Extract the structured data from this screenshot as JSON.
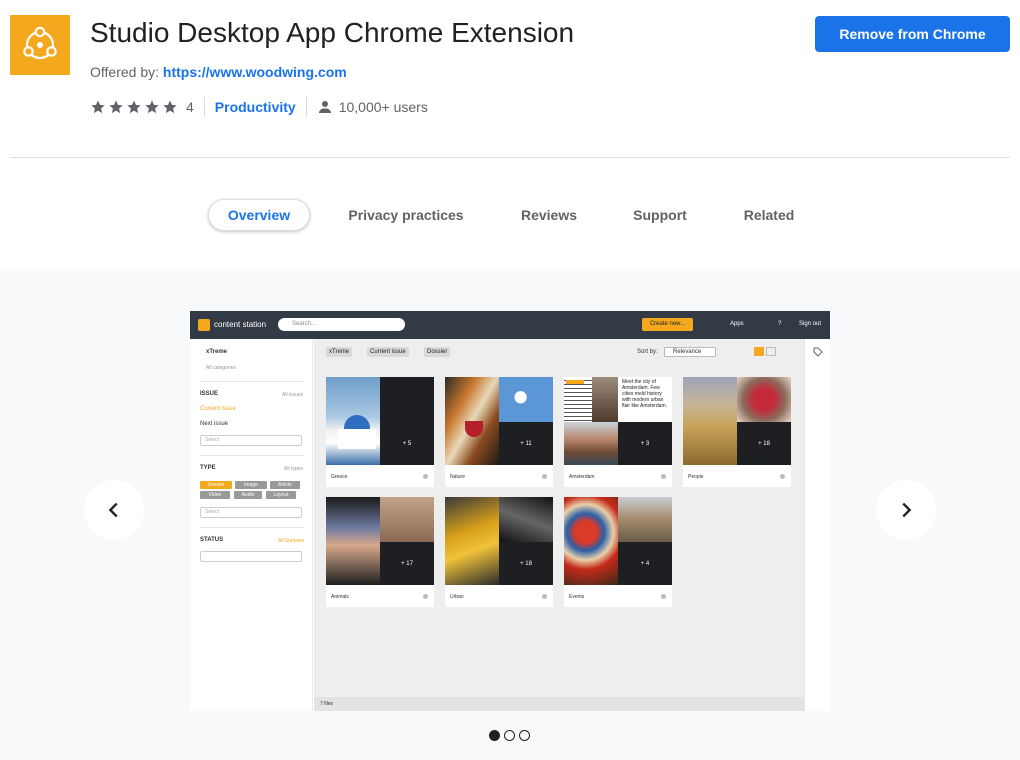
{
  "extension": {
    "title": "Studio Desktop App Chrome Extension",
    "offered_label": "Offered by:",
    "offered_link": "https://www.woodwing.com",
    "rating_count": "4",
    "category": "Productivity",
    "users": "10,000+ users",
    "action_button": "Remove from Chrome",
    "accent": "#1a73e8",
    "logo_color": "#f4a81d"
  },
  "tabs": [
    "Overview",
    "Privacy practices",
    "Reviews",
    "Support",
    "Related"
  ],
  "screenshot": {
    "brand": "content station",
    "search_placeholder": "Search...",
    "create_button": "Create new...",
    "apps": "Apps",
    "help": "?",
    "signout": "Sign out",
    "sidebar": {
      "brand": "xTreme",
      "all_categories": "All categories",
      "issue_heading": "ISSUE",
      "issue_all": "All issues",
      "current_issue": "Current issue",
      "next_issue": "Next issue",
      "select": "Select",
      "type_heading": "TYPE",
      "type_all": "All types",
      "types": [
        "Dossier",
        "Image",
        "Article",
        "Video",
        "Audio",
        "Layout"
      ],
      "status_heading": "STATUS",
      "status_all": "All Statuses"
    },
    "filters": [
      "xTreme",
      "Current issue",
      "Dossier"
    ],
    "sort_label": "Sort by:",
    "sort_value": "Relevance",
    "article_snippet": "Meet the city of Amsterdam. Few cities meld history with modern urban flair like Amsterdam.",
    "dossiers": [
      {
        "name": "Greece",
        "count": "+ 5"
      },
      {
        "name": "Nature",
        "count": "+ 11"
      },
      {
        "name": "Amsterdam",
        "count": "+ 3"
      },
      {
        "name": "People",
        "count": "+ 18"
      },
      {
        "name": "Animals",
        "count": "+ 17"
      },
      {
        "name": "Urban",
        "count": "+ 18"
      },
      {
        "name": "Events",
        "count": "+ 4"
      }
    ],
    "footer": "7 files"
  }
}
